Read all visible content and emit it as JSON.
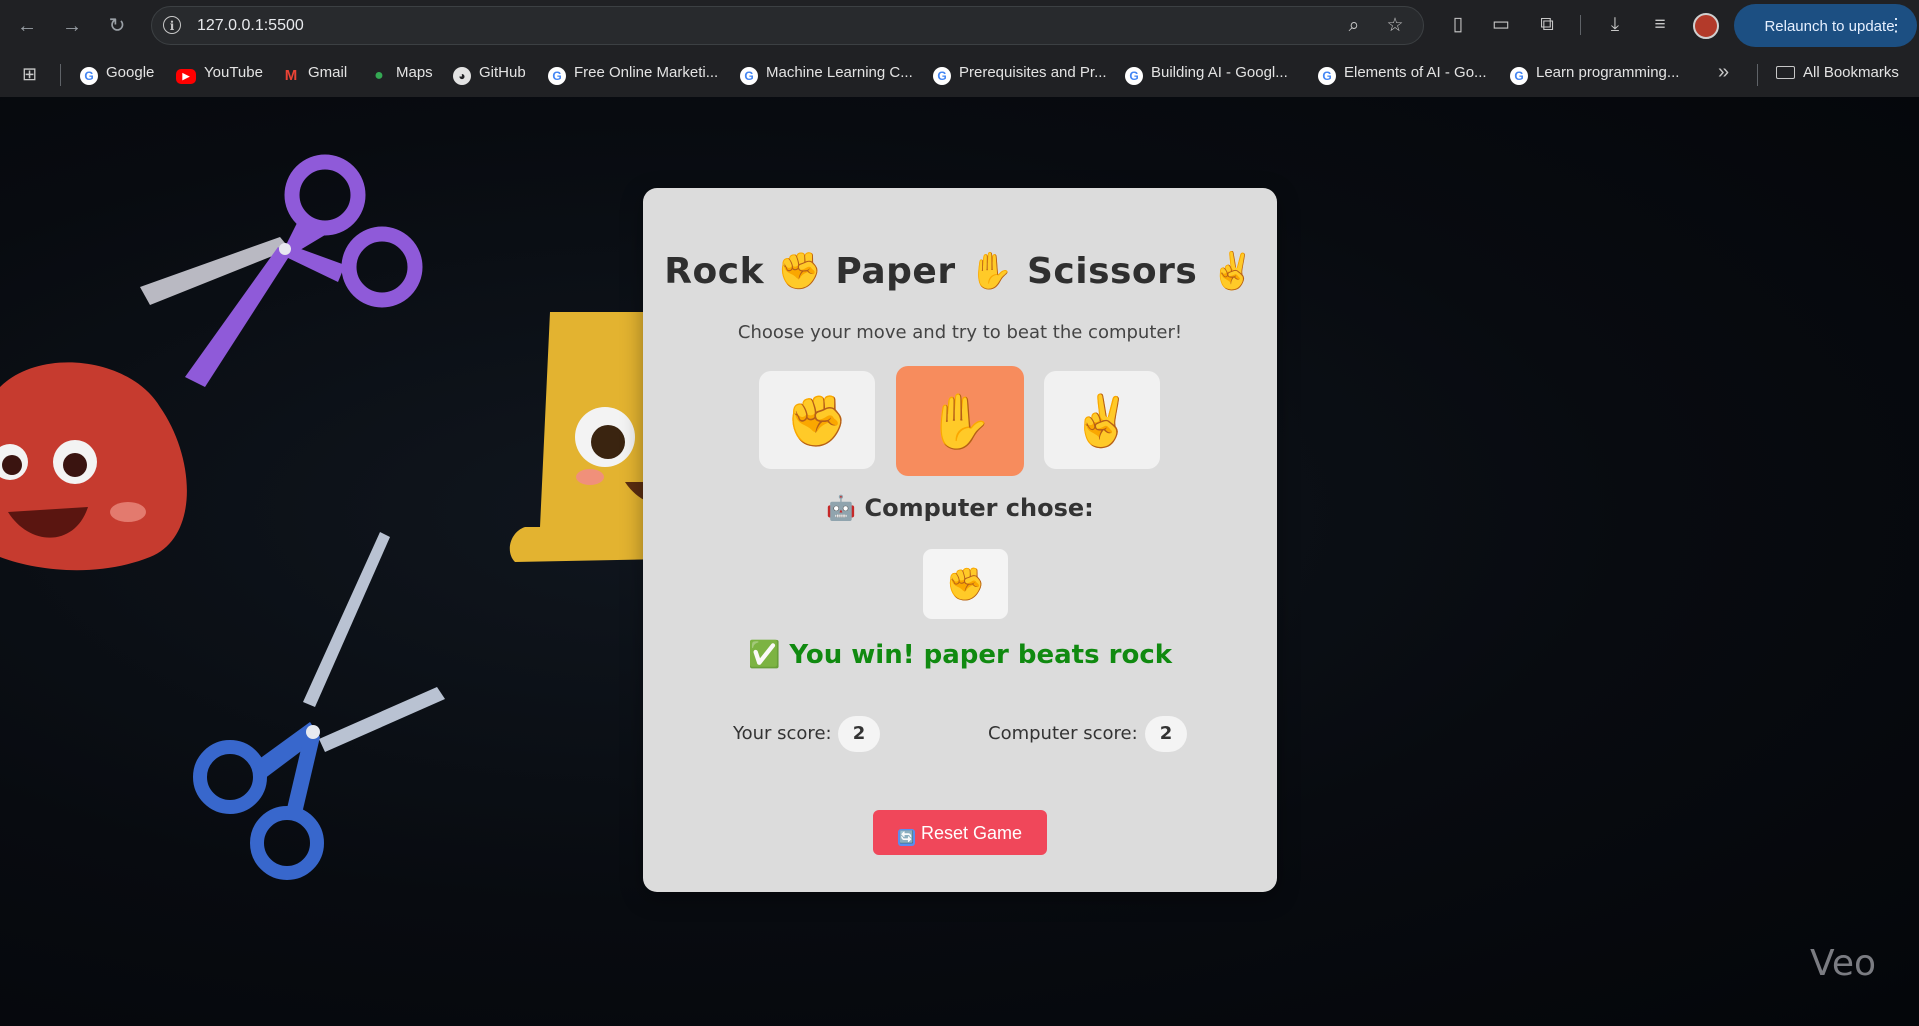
{
  "browser": {
    "url": "127.0.0.1:5500",
    "relaunch_label": "Relaunch to update",
    "bookmarks": [
      {
        "label": "Google",
        "icon": "google-icon"
      },
      {
        "label": "YouTube",
        "icon": "youtube-icon"
      },
      {
        "label": "Gmail",
        "icon": "gmail-icon"
      },
      {
        "label": "Maps",
        "icon": "maps-icon"
      },
      {
        "label": "GitHub",
        "icon": "github-icon"
      },
      {
        "label": "Free Online Marketi...",
        "icon": "google-icon"
      },
      {
        "label": "Machine Learning C...",
        "icon": "google-icon"
      },
      {
        "label": "Prerequisites and Pr...",
        "icon": "google-icon"
      },
      {
        "label": "Building AI - Googl...",
        "icon": "google-icon"
      },
      {
        "label": "Elements of AI - Go...",
        "icon": "google-icon"
      },
      {
        "label": "Learn programming...",
        "icon": "google-icon"
      }
    ],
    "all_bookmarks_label": "All Bookmarks"
  },
  "game": {
    "title": "Rock ✊ Paper ✋ Scissors ✌️",
    "subtitle": "Choose your move and try to beat the computer!",
    "choices": [
      {
        "name": "rock",
        "emoji": "✊",
        "selected": false
      },
      {
        "name": "paper",
        "emoji": "✋",
        "selected": true
      },
      {
        "name": "scissors",
        "emoji": "✌️",
        "selected": false
      }
    ],
    "computer_label": "🤖 Computer chose:",
    "computer_choice_emoji": "✊",
    "result": "✅ You win! paper beats rock",
    "your_score_label": "Your score:",
    "your_score": "2",
    "computer_score_label": "Computer score:",
    "computer_score": "2",
    "reset_label": "Reset Game",
    "reset_icon": "🔄"
  },
  "watermark": "Veo",
  "colors": {
    "selected_choice": "#f78c5d",
    "result_text": "#108a10",
    "reset_button": "#f0475a",
    "relaunch_button": "#1c4f82"
  }
}
